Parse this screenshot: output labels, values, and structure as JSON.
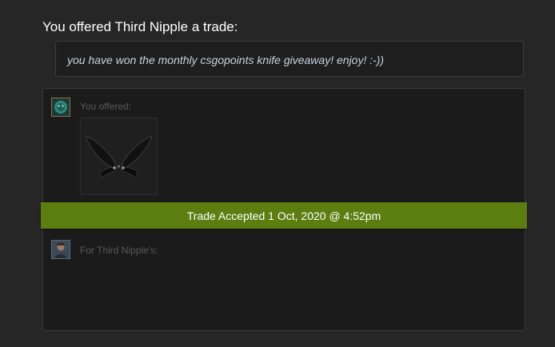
{
  "heading": "You offered Third Nipple a trade:",
  "message": "you have won the monthly csgopoints knife giveaway! enjoy! :-))",
  "offer": {
    "self_label": "You offered:",
    "partner_label": "For Third Nipple's:",
    "items": [
      {
        "icon": "butterfly-knife-icon"
      }
    ]
  },
  "status": {
    "text": "Trade Accepted 1 Oct, 2020 @ 4:52pm",
    "color": "#5c7e10"
  }
}
